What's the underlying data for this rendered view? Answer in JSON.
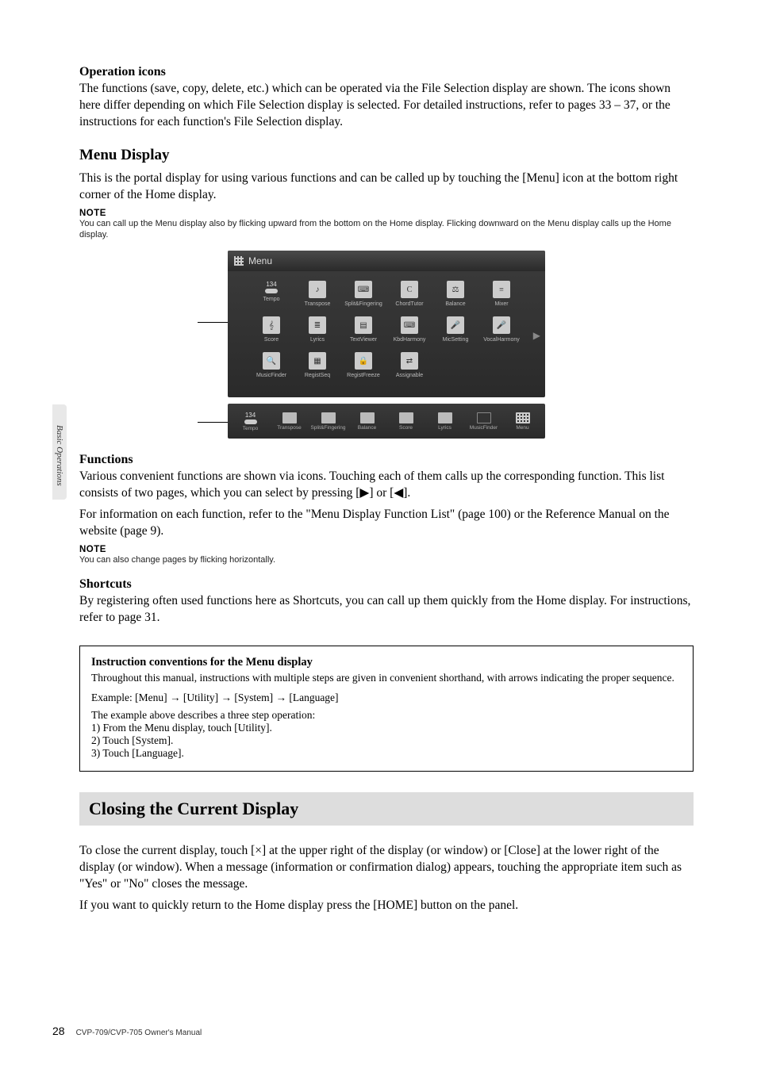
{
  "sidebar_label": "Basic Operations",
  "operation_icons": {
    "heading": "Operation icons",
    "text": "The functions (save, copy, delete, etc.) which can be operated via the File Selection display are shown. The icons shown here differ depending on which File Selection display is selected. For detailed instructions, refer to pages 33 – 37, or the instructions for each function's File Selection display."
  },
  "menu_display": {
    "heading": "Menu Display",
    "intro": "This is the portal display for using various functions and can be called up by touching the [Menu] icon at the bottom right corner of the Home display.",
    "note_label": "NOTE",
    "note_text": "You can call up the Menu display also by flicking upward from the bottom on the Home display. Flicking downward on the Menu display calls up the Home display."
  },
  "menu_screenshot": {
    "title": "Menu",
    "tempo_value": "134",
    "items_row1": [
      {
        "label": "Tempo"
      },
      {
        "label": "Transpose"
      },
      {
        "label": "Split&Fingering"
      },
      {
        "label": "ChordTutor"
      },
      {
        "label": "Balance"
      },
      {
        "label": "Mixer"
      }
    ],
    "items_row2": [
      {
        "label": "Score"
      },
      {
        "label": "Lyrics"
      },
      {
        "label": "TextViewer"
      },
      {
        "label": "KbdHarmony"
      },
      {
        "label": "MicSetting"
      },
      {
        "label": "VocalHarmony"
      }
    ],
    "items_row3": [
      {
        "label": "MusicFinder"
      },
      {
        "label": "RegistSeq"
      },
      {
        "label": "RegistFreeze"
      },
      {
        "label": "Assignable"
      }
    ],
    "shortcuts": [
      {
        "label": "Tempo",
        "value": "134"
      },
      {
        "label": "Transpose"
      },
      {
        "label": "Split&Fingering"
      },
      {
        "label": "Balance"
      },
      {
        "label": "Score"
      },
      {
        "label": "Lyrics"
      },
      {
        "label": "MusicFinder"
      },
      {
        "label": "Menu"
      }
    ]
  },
  "functions": {
    "heading": "Functions",
    "text1": "Various convenient functions are shown via icons. Touching each of them calls up the corresponding function. This list consists of two pages, which you can select by pressing [",
    "tri_right": "▶",
    "text_mid": "] or [",
    "tri_left": "◀",
    "text_end": "].",
    "text2": "For information on each function, refer to the \"Menu Display Function List\" (page 100) or the Reference Manual on the website (page 9).",
    "note_label": "NOTE",
    "note_text": "You can also change pages by flicking horizontally."
  },
  "shortcuts_section": {
    "heading": "Shortcuts",
    "text": "By registering often used functions here as Shortcuts, you can call up them quickly from the Home display. For instructions, refer to page 31."
  },
  "instruction_box": {
    "title": "Instruction conventions for the Menu display",
    "para": "Throughout this manual, instructions with multiple steps are given in convenient shorthand, with arrows indicating the proper sequence.",
    "example": "Example: [Menu] → [Utility] → [System] → [Language]",
    "desc": "The example above describes a three step operation:",
    "step1": "1) From the Menu display, touch [Utility].",
    "step2": "2) Touch [System].",
    "step3": "3) Touch [Language]."
  },
  "closing": {
    "heading": "Closing the Current Display",
    "para1": "To close the current display, touch [×] at the upper right of the display (or window) or [Close] at the lower right of the display (or window). When a message (information or confirmation dialog) appears, touching the appropriate item such as \"Yes\" or \"No\" closes the message.",
    "para2": "If you want to quickly return to the Home display press the [HOME] button on the panel."
  },
  "footer": {
    "page": "28",
    "manual": "CVP-709/CVP-705 Owner's Manual"
  }
}
